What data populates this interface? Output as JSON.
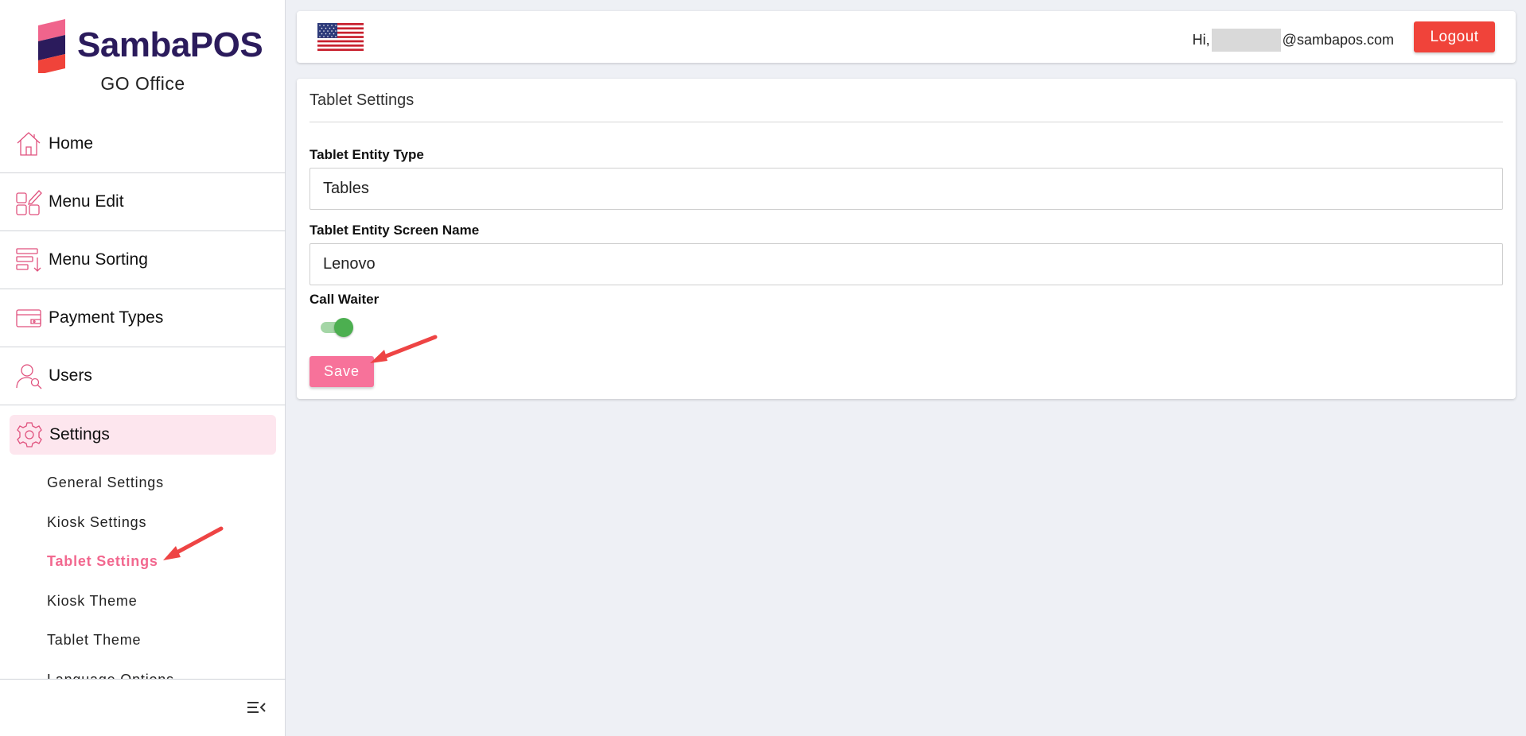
{
  "brand": {
    "name_part1": "Samba",
    "name_part2": "POS",
    "subtitle": "GO Office"
  },
  "sidebar": {
    "items": [
      {
        "label": "Home",
        "icon": "home-icon"
      },
      {
        "label": "Menu Edit",
        "icon": "menu-edit-icon"
      },
      {
        "label": "Menu Sorting",
        "icon": "menu-sorting-icon"
      },
      {
        "label": "Payment Types",
        "icon": "payment-types-icon"
      },
      {
        "label": "Users",
        "icon": "users-icon"
      },
      {
        "label": "Settings",
        "icon": "gear-icon",
        "active": true
      }
    ],
    "sub_items": [
      {
        "label": "General Settings"
      },
      {
        "label": "Kiosk Settings"
      },
      {
        "label": "Tablet Settings",
        "active": true
      },
      {
        "label": "Kiosk Theme"
      },
      {
        "label": "Tablet Theme"
      },
      {
        "label": "Language Options"
      }
    ],
    "collapse_icon": "collapse-menu-icon"
  },
  "header": {
    "greeting_prefix": "Hi,",
    "email_suffix": "@sambapos.com",
    "logout_label": "Logout",
    "flag_icon": "us-flag-icon"
  },
  "main": {
    "title": "Tablet Settings",
    "fields": {
      "entity_type_label": "Tablet Entity Type",
      "entity_type_value": "Tables",
      "screen_name_label": "Tablet Entity Screen Name",
      "screen_name_value": "Lenovo",
      "call_waiter_label": "Call Waiter",
      "call_waiter_enabled": true
    },
    "save_label": "Save"
  },
  "colors": {
    "accent_pink": "#f2688f",
    "save_button": "#f7729a",
    "logout_button": "#f0433a",
    "toggle_on": "#4caf50",
    "annotation_arrow": "#ee4444"
  }
}
